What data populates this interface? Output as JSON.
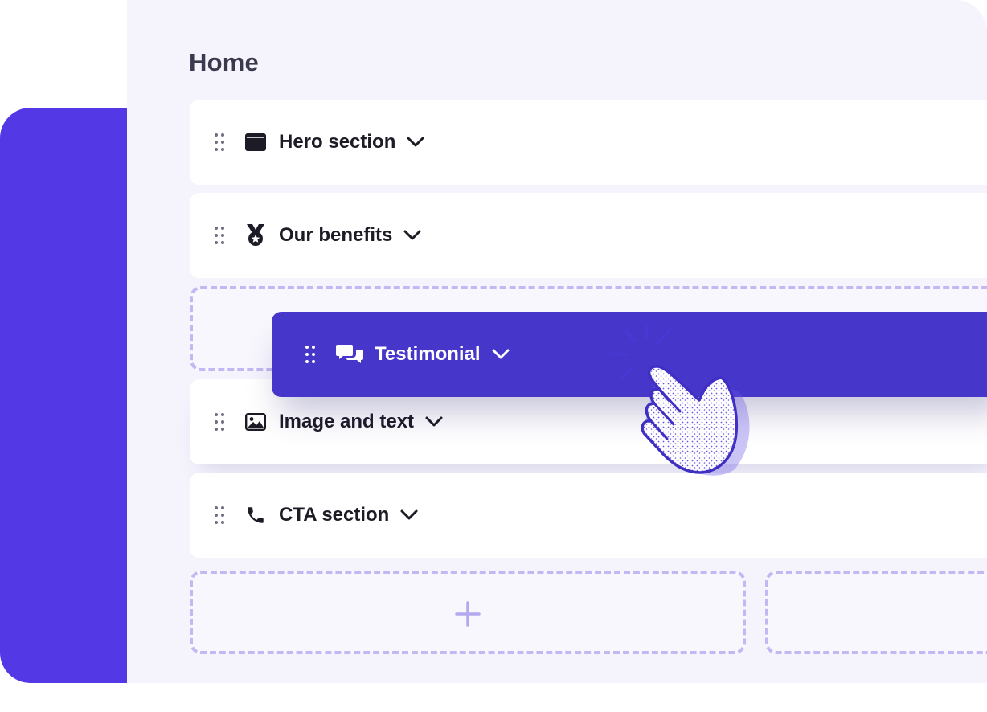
{
  "page": {
    "title": "Home"
  },
  "sections": [
    {
      "label": "Hero section",
      "icon": "browser-window-icon"
    },
    {
      "label": "Our benefits",
      "icon": "medal-icon"
    },
    {
      "label": "Image and text",
      "icon": "image-icon"
    },
    {
      "label": "CTA section",
      "icon": "phone-icon"
    }
  ],
  "dragging": {
    "label": "Testimonial",
    "icon": "chat-bubbles-icon"
  },
  "add_zone": {
    "symbol": "+"
  },
  "colors": {
    "accent": "#5239e5",
    "drag_card": "#4636c9",
    "panel_bg": "#f5f4fd",
    "dashed_border": "#c3b8f3"
  }
}
